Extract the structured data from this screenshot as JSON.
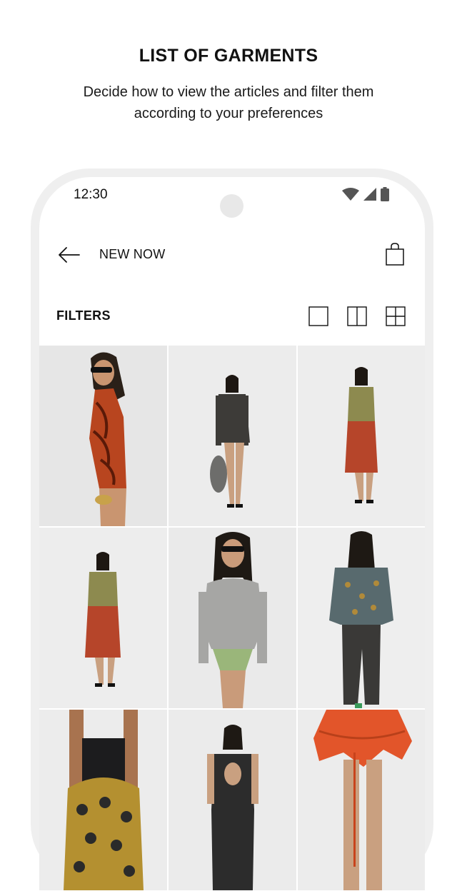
{
  "promo": {
    "title": "LIST OF GARMENTS",
    "subtitle": "Decide how to view the articles and filter them according to your preferences"
  },
  "status_bar": {
    "time": "12:30",
    "icons": [
      "wifi-icon",
      "cellular-signal-icon",
      "battery-icon"
    ]
  },
  "app_bar": {
    "back_icon": "arrow-left-icon",
    "title": "NEW NOW",
    "bag_icon": "shopping-bag-icon"
  },
  "toolbar": {
    "filters_label": "FILTERS",
    "view_options": [
      "single-column-view-icon",
      "two-column-view-icon",
      "four-grid-view-icon"
    ]
  },
  "products": [
    {
      "name": "model-orange-swimsuit"
    },
    {
      "name": "model-grey-blazer"
    },
    {
      "name": "model-olive-cardigan-red-skirt"
    },
    {
      "name": "model-olive-cardigan-red-skirt-2"
    },
    {
      "name": "model-grey-knit-top"
    },
    {
      "name": "model-printed-shirt-back"
    },
    {
      "name": "model-patterned-bag"
    },
    {
      "name": "model-black-open-back-top"
    },
    {
      "name": "model-orange-skirt"
    }
  ],
  "colors": {
    "text": "#111111",
    "phone_frame": "#efefef",
    "tile_background": "#ececec"
  }
}
